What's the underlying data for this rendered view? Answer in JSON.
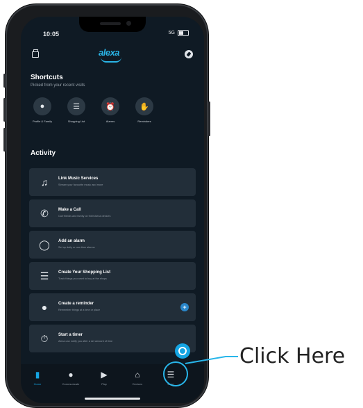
{
  "status": {
    "time": "10:05",
    "network": "5G"
  },
  "header": {
    "logo": "alexa"
  },
  "shortcuts": {
    "title": "Shortcuts",
    "subtitle": "Picked from your recent visits",
    "items": [
      {
        "label": "Profile & Family",
        "icon": "person-icon"
      },
      {
        "label": "Shopping List",
        "icon": "list-icon"
      },
      {
        "label": "Alarms",
        "icon": "alarm-icon"
      },
      {
        "label": "Reminders",
        "icon": "hand-icon"
      }
    ]
  },
  "activity": {
    "title": "Activity",
    "cards": [
      {
        "title": "Link Music Services",
        "subtitle": "Stream your favourite music and more"
      },
      {
        "title": "Make a Call",
        "subtitle": "Call friends and family on their Alexa devices"
      },
      {
        "title": "Add an alarm",
        "subtitle": "Set up daily or one-time alarms"
      },
      {
        "title": "Create Your Shopping List",
        "subtitle": "Track things you want to buy at the shops"
      },
      {
        "title": "Create a reminder",
        "subtitle": "Remember things at a time or place"
      },
      {
        "title": "Start a timer",
        "subtitle": "Alexa can notify you after a set amount of time"
      }
    ]
  },
  "nav": {
    "items": [
      {
        "label": "Home",
        "icon": "home-icon"
      },
      {
        "label": "Communicate",
        "icon": "chat-icon"
      },
      {
        "label": "Play",
        "icon": "play-icon"
      },
      {
        "label": "Devices",
        "icon": "devices-icon"
      },
      {
        "label": "More",
        "icon": "menu-icon"
      }
    ]
  },
  "annotation": {
    "text": "Click Here"
  },
  "colors": {
    "accent": "#15a5e3",
    "background": "#0f1a24",
    "card": "#222e39"
  }
}
